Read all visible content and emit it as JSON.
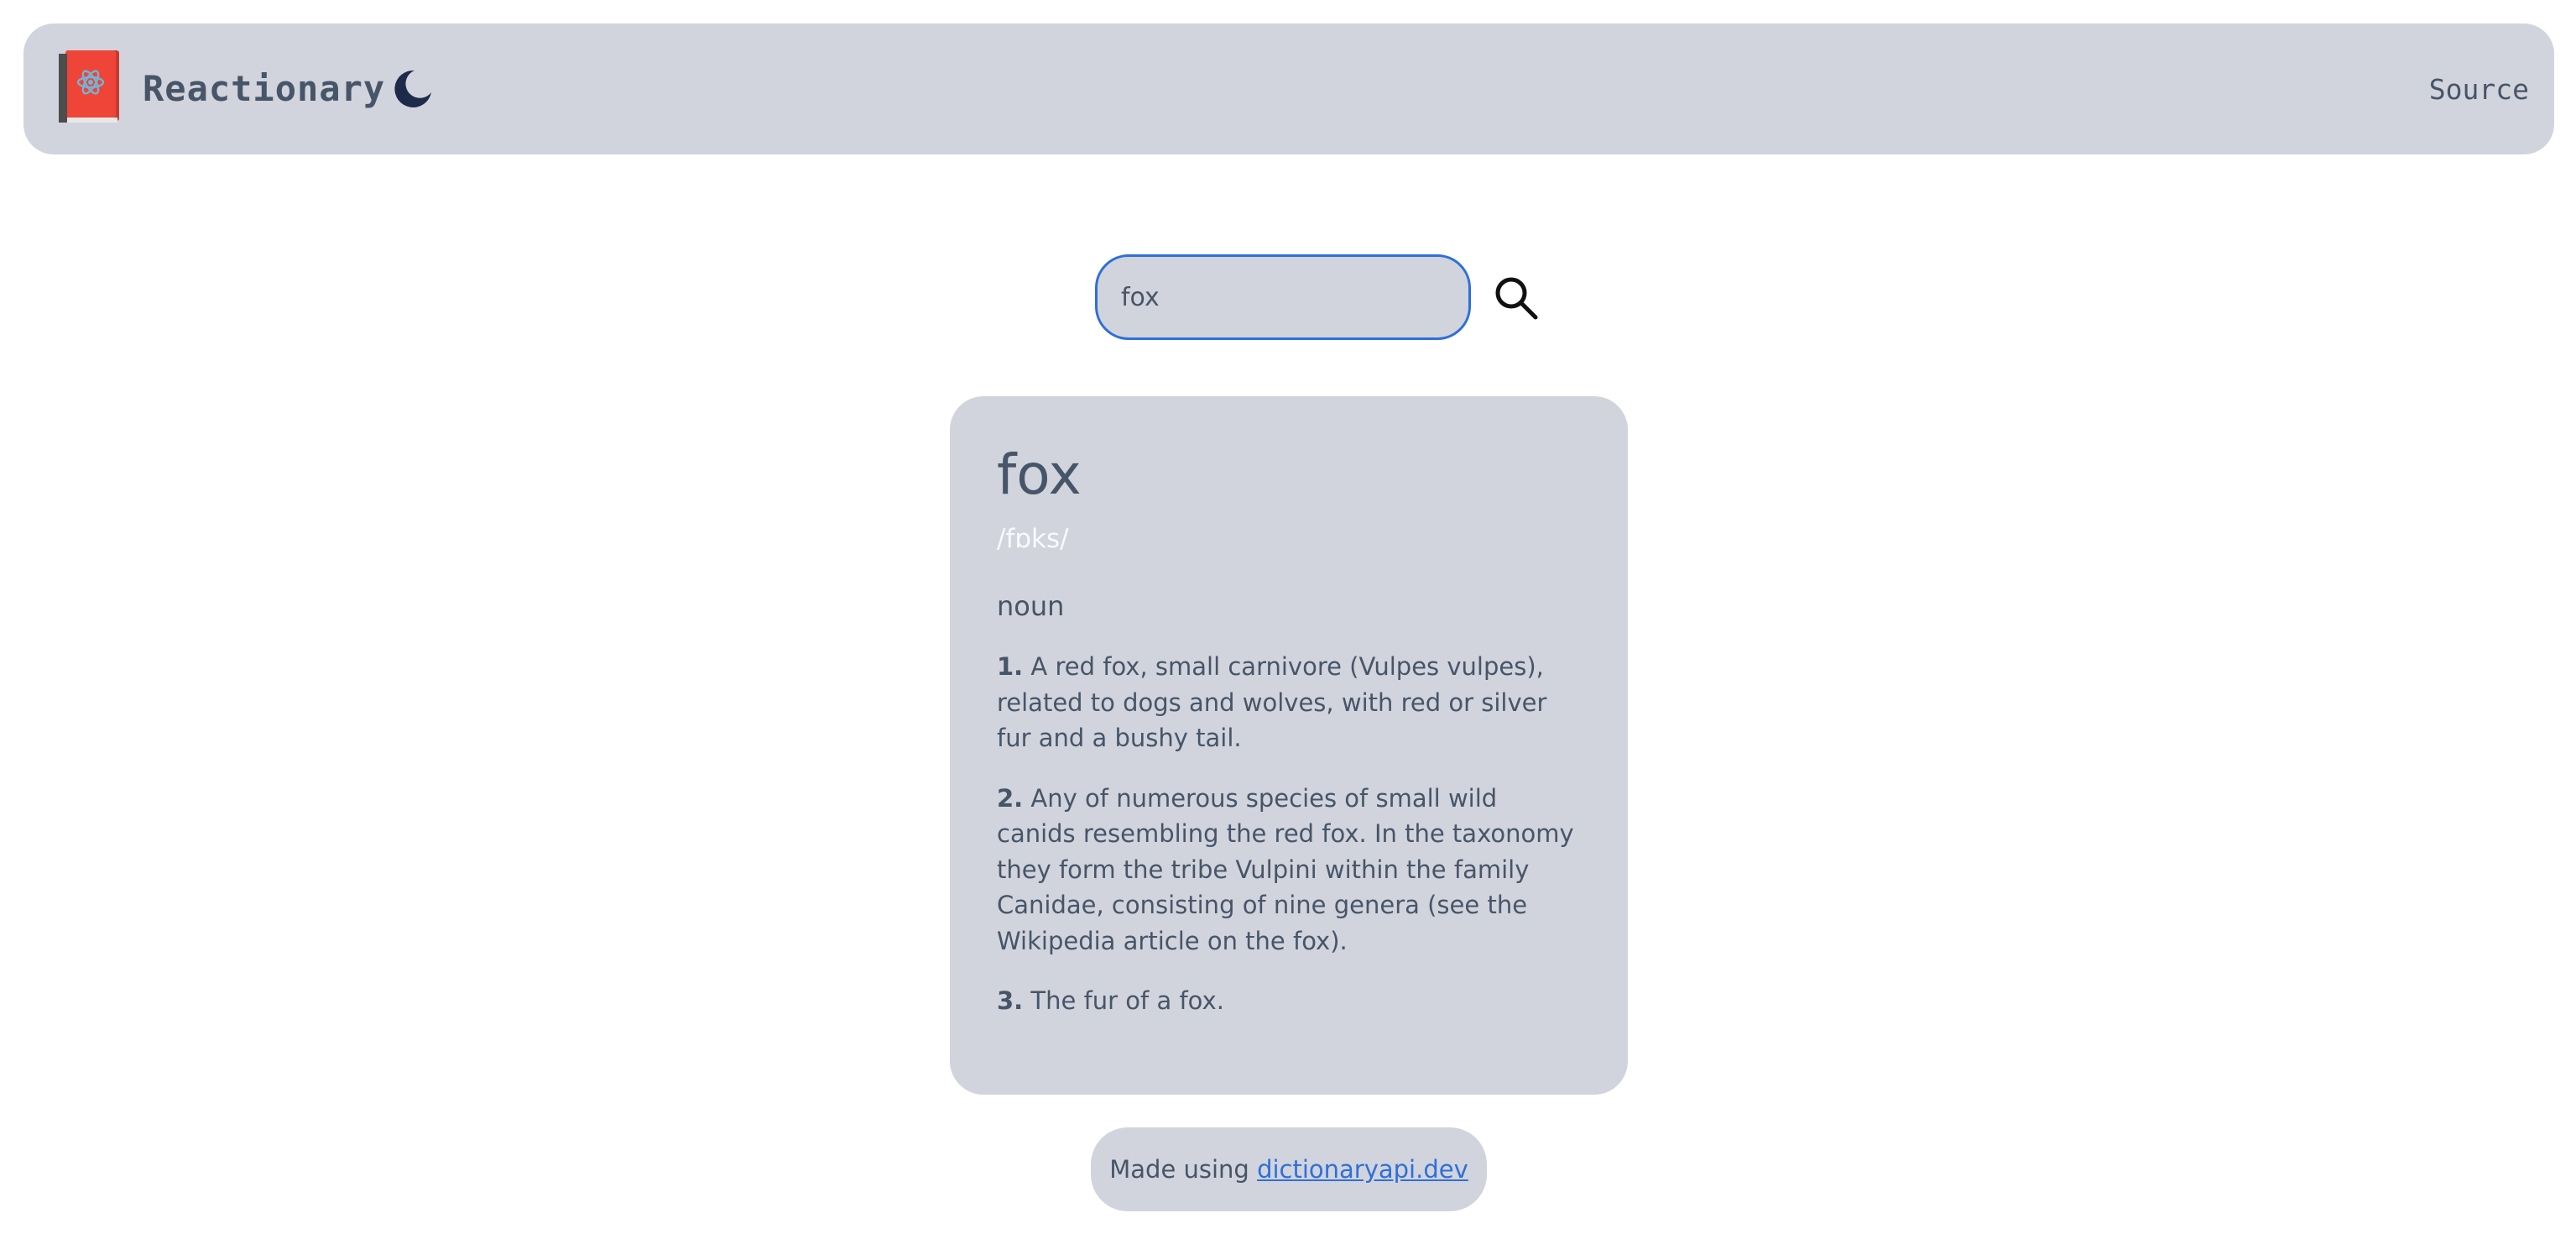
{
  "header": {
    "brand": "Reactionary",
    "source_label": "Source",
    "logo_icon": "book-react-icon",
    "theme_icon": "moon-icon"
  },
  "search": {
    "value": "fox",
    "icon": "search-icon"
  },
  "entry": {
    "word": "fox",
    "phonetic": "/fɒks/",
    "part_of_speech": "noun",
    "definitions": [
      {
        "number": "1.",
        "text": "A red fox, small carnivore (Vulpes vulpes), related to dogs and wolves, with red or silver fur and a bushy tail."
      },
      {
        "number": "2.",
        "text": "Any of numerous species of small wild canids resembling the red fox. In the taxonomy they form the tribe Vulpini within the family Canidae, consisting of nine genera (see the Wikipedia article on the fox)."
      },
      {
        "number": "3.",
        "text": "The fur of a fox."
      }
    ]
  },
  "footer": {
    "prefix": "Made using ",
    "link_text": "dictionaryapi.dev"
  },
  "colors": {
    "panel": "#d1d4dc",
    "text": "#475569",
    "accent": "#2f6fd8",
    "moon": "#1e2a4a",
    "book_red": "#e8453c"
  }
}
